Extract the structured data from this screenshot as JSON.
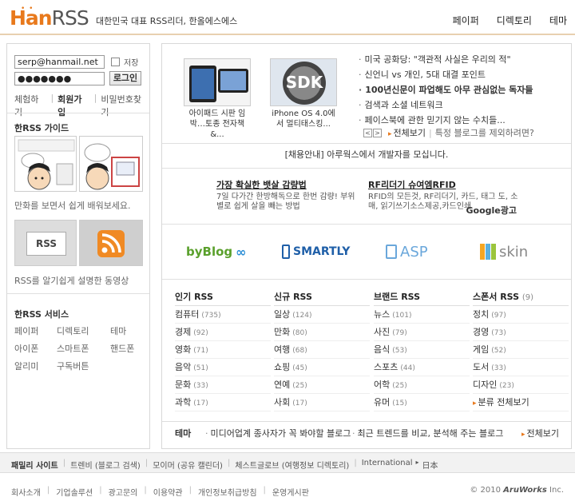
{
  "header": {
    "logo_han": "Han",
    "logo_rss": "RSS",
    "tagline": "대한민국 대표 RSS리더, 한올에스에스",
    "nav": [
      "페이퍼",
      "디렉토리",
      "테마"
    ]
  },
  "login": {
    "email": "serp@hanmail.net",
    "password": "●●●●●●●",
    "save_label": "저장",
    "login_button": "로그인",
    "links": [
      "체험하기",
      "회원가입",
      "비밀번호찾기"
    ]
  },
  "guide": {
    "title": "한RSS 가이드",
    "caption1": "만화를 보면서 쉽게 배워보세요.",
    "caption2": "RSS를 알기쉽게 설명한 동영상",
    "thumb_rss_text": "RSS"
  },
  "services": {
    "title": "한RSS 서비스",
    "items": [
      "페이퍼",
      "디렉토리",
      "테마",
      "아이폰",
      "스마트폰",
      "핸드폰",
      "알리미",
      "구독버튼"
    ]
  },
  "news": {
    "thumbs": [
      {
        "caption": "아이패드 시판 임박…토종 전자책 &..."
      },
      {
        "caption": "iPhone OS 4.0에서 멀티태스킹..."
      }
    ],
    "sdk_text": "SDK",
    "headlines": [
      "미국 공화당: \"객관적 사실은 우리의 적\"",
      "신언니 vs 개인, 5대 대결 포인트",
      "100년신문이 파업해도 아무 관심없는 독자들",
      "검색과 소셜 네트워크",
      "페이스북에 관한 믿기지 않는 수치들..."
    ],
    "more": "전체보기",
    "exclude_note": "특정 블로그를 제외하려면?"
  },
  "notice": "[채용안내] 아루웍스에서 개발자를 모십니다.",
  "ads": {
    "ad1_title": "가장 확실한 뱃살 감량법",
    "ad1_body": "7일 다가간 한방해독으로 한번 감량! 부위별로 쉽게 살을 빼는 방법",
    "ad2_title": "RF리더기 슈여엠RFID",
    "ad2_body": "RFID의 모든것, RF리더기, 카드, 태그 도, 소매, 읽기쓰기소스제공,카드인쇄",
    "google": "Google광고"
  },
  "partners": [
    "byBlog",
    "SMARTLY",
    "ASP",
    "skin"
  ],
  "categories": [
    {
      "title": "인기 RSS",
      "rows": [
        {
          "name": "컴퓨터",
          "count": "(735)"
        },
        {
          "name": "경제",
          "count": "(92)"
        },
        {
          "name": "영화",
          "count": "(71)"
        },
        {
          "name": "음악",
          "count": "(51)"
        },
        {
          "name": "문화",
          "count": "(33)"
        },
        {
          "name": "과학",
          "count": "(17)"
        }
      ]
    },
    {
      "title": "신규 RSS",
      "rows": [
        {
          "name": "일상",
          "count": "(124)"
        },
        {
          "name": "만화",
          "count": "(80)"
        },
        {
          "name": "여행",
          "count": "(68)"
        },
        {
          "name": "쇼핑",
          "count": "(45)"
        },
        {
          "name": "연예",
          "count": "(25)"
        },
        {
          "name": "사회",
          "count": "(17)"
        }
      ]
    },
    {
      "title": "브랜드 RSS",
      "rows": [
        {
          "name": "뉴스",
          "count": "(101)"
        },
        {
          "name": "사진",
          "count": "(79)"
        },
        {
          "name": "음식",
          "count": "(53)"
        },
        {
          "name": "스포츠",
          "count": "(44)"
        },
        {
          "name": "어학",
          "count": "(25)"
        },
        {
          "name": "유머",
          "count": "(15)"
        }
      ]
    },
    {
      "title": "스폰서 RSS",
      "title_count": "(9)",
      "rows": [
        {
          "name": "정치",
          "count": "(97)"
        },
        {
          "name": "경영",
          "count": "(73)"
        },
        {
          "name": "게임",
          "count": "(52)"
        },
        {
          "name": "도서",
          "count": "(33)"
        },
        {
          "name": "디자인",
          "count": "(23)"
        }
      ],
      "more": "분류 전체보기"
    }
  ],
  "theme": {
    "label": "테마",
    "items": [
      "미디어업계 종사자가 꼭 봐야할 블로그",
      "최근 트렌드를 비교, 분석해 주는 블로그"
    ],
    "all": "전체보기"
  },
  "family": {
    "title": "패밀리 사이트",
    "sites": [
      "트렌비 (블로그 검색)",
      "모이머 (공유 캘린더)",
      "체스트글로브 (여행정보 디렉토리)"
    ],
    "international": "International",
    "japan": "日本"
  },
  "footer": {
    "links": [
      "회사소개",
      "기업솔루션",
      "광고문의",
      "이용약관",
      "개인정보취급방침",
      "운영게시판"
    ],
    "copyright": "© 2010",
    "company": "AruWorks",
    "inc": "Inc."
  },
  "colors": {
    "brand": "#e8791c",
    "border": "#d8d8d8"
  }
}
